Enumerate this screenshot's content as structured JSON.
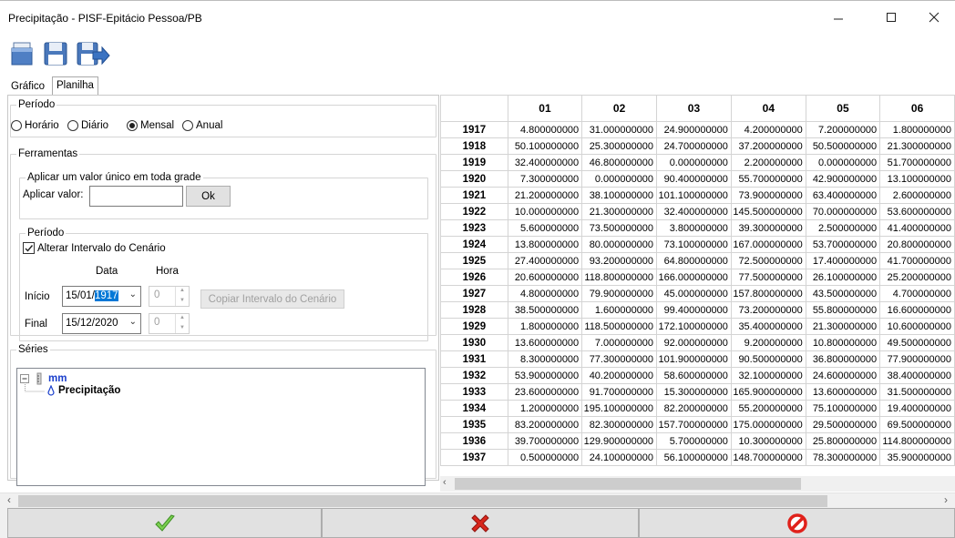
{
  "window": {
    "title": "Precipitação - PISF-Epitácio Pessoa/PB",
    "minimize_label": "—",
    "maximize_label": "☐",
    "close_label": "✕"
  },
  "toolbar": {
    "buttons": [
      {
        "name": "open-icon"
      },
      {
        "name": "save-icon"
      },
      {
        "name": "save-as-icon"
      }
    ]
  },
  "tabs": {
    "grafico": "Gráfico",
    "planilha": "Planilha",
    "active": "Planilha"
  },
  "periodo": {
    "legend": "Período",
    "options": [
      "Horário",
      "Diário",
      "Mensal",
      "Anual"
    ],
    "selected": "Mensal"
  },
  "ferramentas": {
    "legend": "Ferramentas",
    "valor_unico": {
      "legend": "Aplicar um valor único em toda grade",
      "label": "Aplicar valor:",
      "value": "",
      "ok_label": "Ok"
    },
    "periodo": {
      "legend": "Período",
      "checkbox_label": "Alterar Intervalo do Cenário",
      "checked": true,
      "data_header": "Data",
      "hora_header": "Hora",
      "inicio_label": "Início",
      "inicio_date_prefix": "15/01/",
      "inicio_date_selected": "1917",
      "inicio_hour": "0",
      "final_label": "Final",
      "final_date": "15/12/2020",
      "final_hour": "0",
      "copy_button": "Copiar Intervalo do Cenário"
    }
  },
  "series": {
    "legend": "Séries",
    "root_label": "mm",
    "child_label": "Precipitação"
  },
  "grid": {
    "columns": [
      "01",
      "02",
      "03",
      "04",
      "05",
      "06"
    ],
    "rows": [
      {
        "year": "1917",
        "values": [
          "4.800000000",
          "31.000000000",
          "24.900000000",
          "4.200000000",
          "7.200000000",
          "1.800000000"
        ]
      },
      {
        "year": "1918",
        "values": [
          "50.100000000",
          "25.300000000",
          "24.700000000",
          "37.200000000",
          "50.500000000",
          "21.300000000"
        ]
      },
      {
        "year": "1919",
        "values": [
          "32.400000000",
          "46.800000000",
          "0.000000000",
          "2.200000000",
          "0.000000000",
          "51.700000000"
        ]
      },
      {
        "year": "1920",
        "values": [
          "7.300000000",
          "0.000000000",
          "90.400000000",
          "55.700000000",
          "42.900000000",
          "13.100000000"
        ]
      },
      {
        "year": "1921",
        "values": [
          "21.200000000",
          "38.100000000",
          "101.100000000",
          "73.900000000",
          "63.400000000",
          "2.600000000"
        ]
      },
      {
        "year": "1922",
        "values": [
          "10.000000000",
          "21.300000000",
          "32.400000000",
          "145.500000000",
          "70.000000000",
          "53.600000000"
        ]
      },
      {
        "year": "1923",
        "values": [
          "5.600000000",
          "73.500000000",
          "3.800000000",
          "39.300000000",
          "2.500000000",
          "41.400000000"
        ]
      },
      {
        "year": "1924",
        "values": [
          "13.800000000",
          "80.000000000",
          "73.100000000",
          "167.000000000",
          "53.700000000",
          "20.800000000"
        ]
      },
      {
        "year": "1925",
        "values": [
          "27.400000000",
          "93.200000000",
          "64.800000000",
          "72.500000000",
          "17.400000000",
          "41.700000000"
        ]
      },
      {
        "year": "1926",
        "values": [
          "20.600000000",
          "118.800000000",
          "166.000000000",
          "77.500000000",
          "26.100000000",
          "25.200000000"
        ]
      },
      {
        "year": "1927",
        "values": [
          "4.800000000",
          "79.900000000",
          "45.000000000",
          "157.800000000",
          "43.500000000",
          "4.700000000"
        ]
      },
      {
        "year": "1928",
        "values": [
          "38.500000000",
          "1.600000000",
          "99.400000000",
          "73.200000000",
          "55.800000000",
          "16.600000000"
        ]
      },
      {
        "year": "1929",
        "values": [
          "1.800000000",
          "118.500000000",
          "172.100000000",
          "35.400000000",
          "21.300000000",
          "10.600000000"
        ]
      },
      {
        "year": "1930",
        "values": [
          "13.600000000",
          "7.000000000",
          "92.000000000",
          "9.200000000",
          "10.800000000",
          "49.500000000"
        ]
      },
      {
        "year": "1931",
        "values": [
          "8.300000000",
          "77.300000000",
          "101.900000000",
          "90.500000000",
          "36.800000000",
          "77.900000000"
        ]
      },
      {
        "year": "1932",
        "values": [
          "53.900000000",
          "40.200000000",
          "58.600000000",
          "32.100000000",
          "24.600000000",
          "38.400000000"
        ]
      },
      {
        "year": "1933",
        "values": [
          "23.600000000",
          "91.700000000",
          "15.300000000",
          "165.900000000",
          "13.600000000",
          "31.500000000"
        ]
      },
      {
        "year": "1934",
        "values": [
          "1.200000000",
          "195.100000000",
          "82.200000000",
          "55.200000000",
          "75.100000000",
          "19.400000000"
        ]
      },
      {
        "year": "1935",
        "values": [
          "83.200000000",
          "82.300000000",
          "157.700000000",
          "175.000000000",
          "29.500000000",
          "69.500000000"
        ]
      },
      {
        "year": "1936",
        "values": [
          "39.700000000",
          "129.900000000",
          "5.700000000",
          "10.300000000",
          "25.800000000",
          "114.800000000"
        ]
      },
      {
        "year": "1937",
        "values": [
          "0.500000000",
          "24.100000000",
          "56.100000000",
          "148.700000000",
          "78.300000000",
          "35.900000000"
        ]
      }
    ]
  },
  "actions": [
    {
      "name": "confirm-button",
      "icon": "check-icon",
      "color": "#6cc04a"
    },
    {
      "name": "cancel-button",
      "icon": "x-icon",
      "color": "#d9261c"
    },
    {
      "name": "delete-button",
      "icon": "prohibited-icon",
      "color": "#e0211b"
    }
  ],
  "colors": {
    "accent": "#0078d7",
    "tree_root": "#1a3fcc"
  }
}
